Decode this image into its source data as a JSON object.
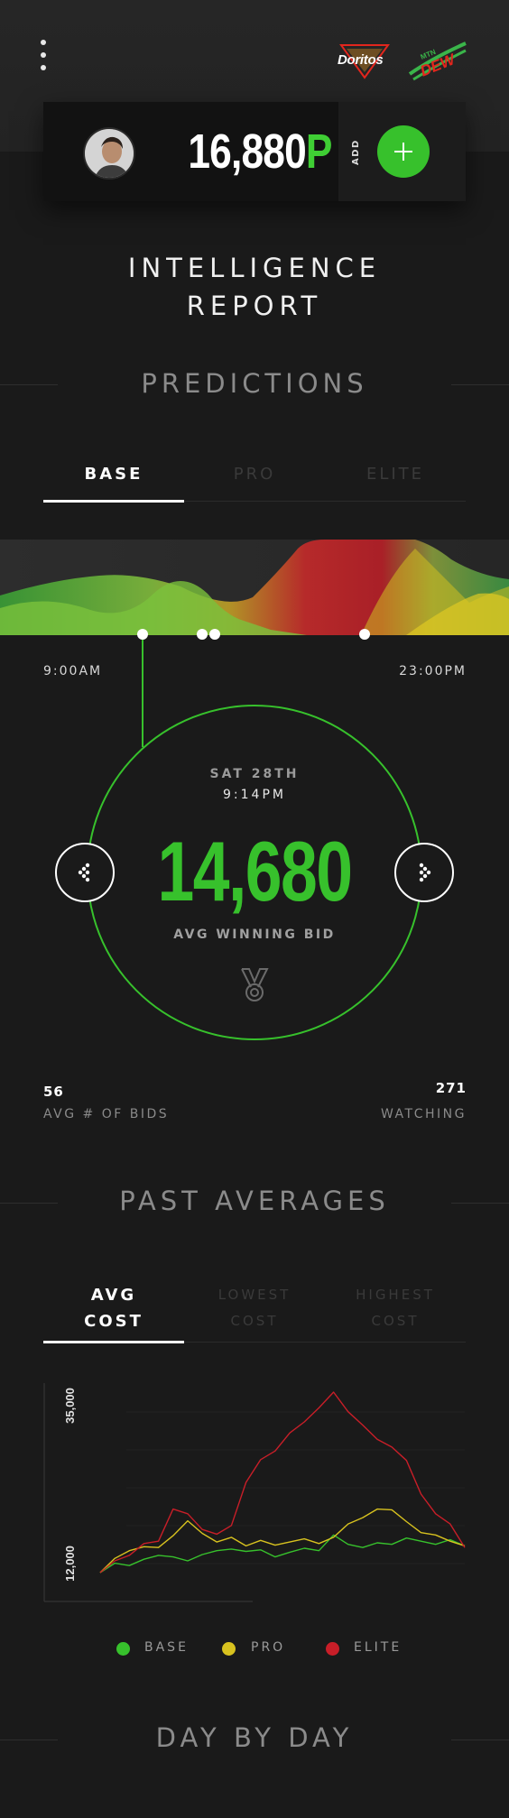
{
  "header": {
    "brand_left": "Doritos",
    "brand_right": "MTN DEW"
  },
  "balance": {
    "amount": "16,880",
    "unit": "P",
    "add_label": "ADD"
  },
  "title_line1": "INTELLIGENCE",
  "title_line2": "REPORT",
  "predictions": {
    "heading": "PREDICTIONS",
    "tabs": [
      "BASE",
      "PRO",
      "ELITE"
    ],
    "active_tab": 0,
    "time_start": "9:00AM",
    "time_end": "23:00PM",
    "date": "SAT 28TH",
    "time": "9:14PM",
    "avg_winning_bid": "14,680",
    "avg_winning_bid_label": "AVG WINNING BID",
    "bids_count": "56",
    "bids_label": "AVG # OF BIDS",
    "watching_count": "271",
    "watching_label": "WATCHING"
  },
  "past_averages": {
    "heading": "PAST AVERAGES",
    "tabs": [
      {
        "line1": "AVG",
        "line2": "COST"
      },
      {
        "line1": "LOWEST",
        "line2": "COST"
      },
      {
        "line1": "HIGHEST",
        "line2": "COST"
      }
    ],
    "active_tab": 0,
    "legend": [
      "BASE",
      "PRO",
      "ELITE"
    ]
  },
  "day_by_day": {
    "heading": "DAY BY DAY"
  },
  "colors": {
    "accent_green": "#37c12c",
    "base": "#37c12c",
    "pro": "#d8c21f",
    "elite": "#c81e28"
  },
  "chart_data": {
    "type": "line",
    "title": "",
    "xlabel": "",
    "ylabel": "",
    "yticks": [
      "12,000",
      "35,000"
    ],
    "ylim": [
      12000,
      35000
    ],
    "x": [
      1,
      2,
      3,
      4,
      5,
      6,
      7,
      8,
      9,
      10,
      11,
      12,
      13,
      14,
      15,
      16,
      17,
      18,
      19,
      20,
      21,
      22,
      23,
      24,
      25,
      26
    ],
    "series": [
      {
        "name": "BASE",
        "color": "#37c12c",
        "values": [
          12000,
          13200,
          12900,
          13700,
          14200,
          14000,
          13500,
          14300,
          14800,
          15000,
          14700,
          14900,
          14000,
          14600,
          15100,
          14800,
          16800,
          15600,
          15200,
          15800,
          15600,
          16400,
          16000,
          15600,
          16200,
          15400
        ]
      },
      {
        "name": "PRO",
        "color": "#d8c21f",
        "values": [
          12000,
          13800,
          14800,
          15300,
          15200,
          16700,
          18600,
          17000,
          15900,
          16500,
          15400,
          16100,
          15500,
          15900,
          16300,
          15700,
          16500,
          18200,
          19000,
          20100,
          20000,
          18500,
          17100,
          16800,
          16000,
          15400
        ]
      },
      {
        "name": "ELITE",
        "color": "#c81e28",
        "values": [
          12000,
          13500,
          14200,
          15700,
          16000,
          20100,
          19500,
          17500,
          16900,
          18000,
          23500,
          26400,
          27500,
          29800,
          31200,
          33000,
          35000,
          32500,
          30800,
          29000,
          28000,
          26300,
          22000,
          19500,
          18200,
          15200
        ]
      }
    ]
  }
}
